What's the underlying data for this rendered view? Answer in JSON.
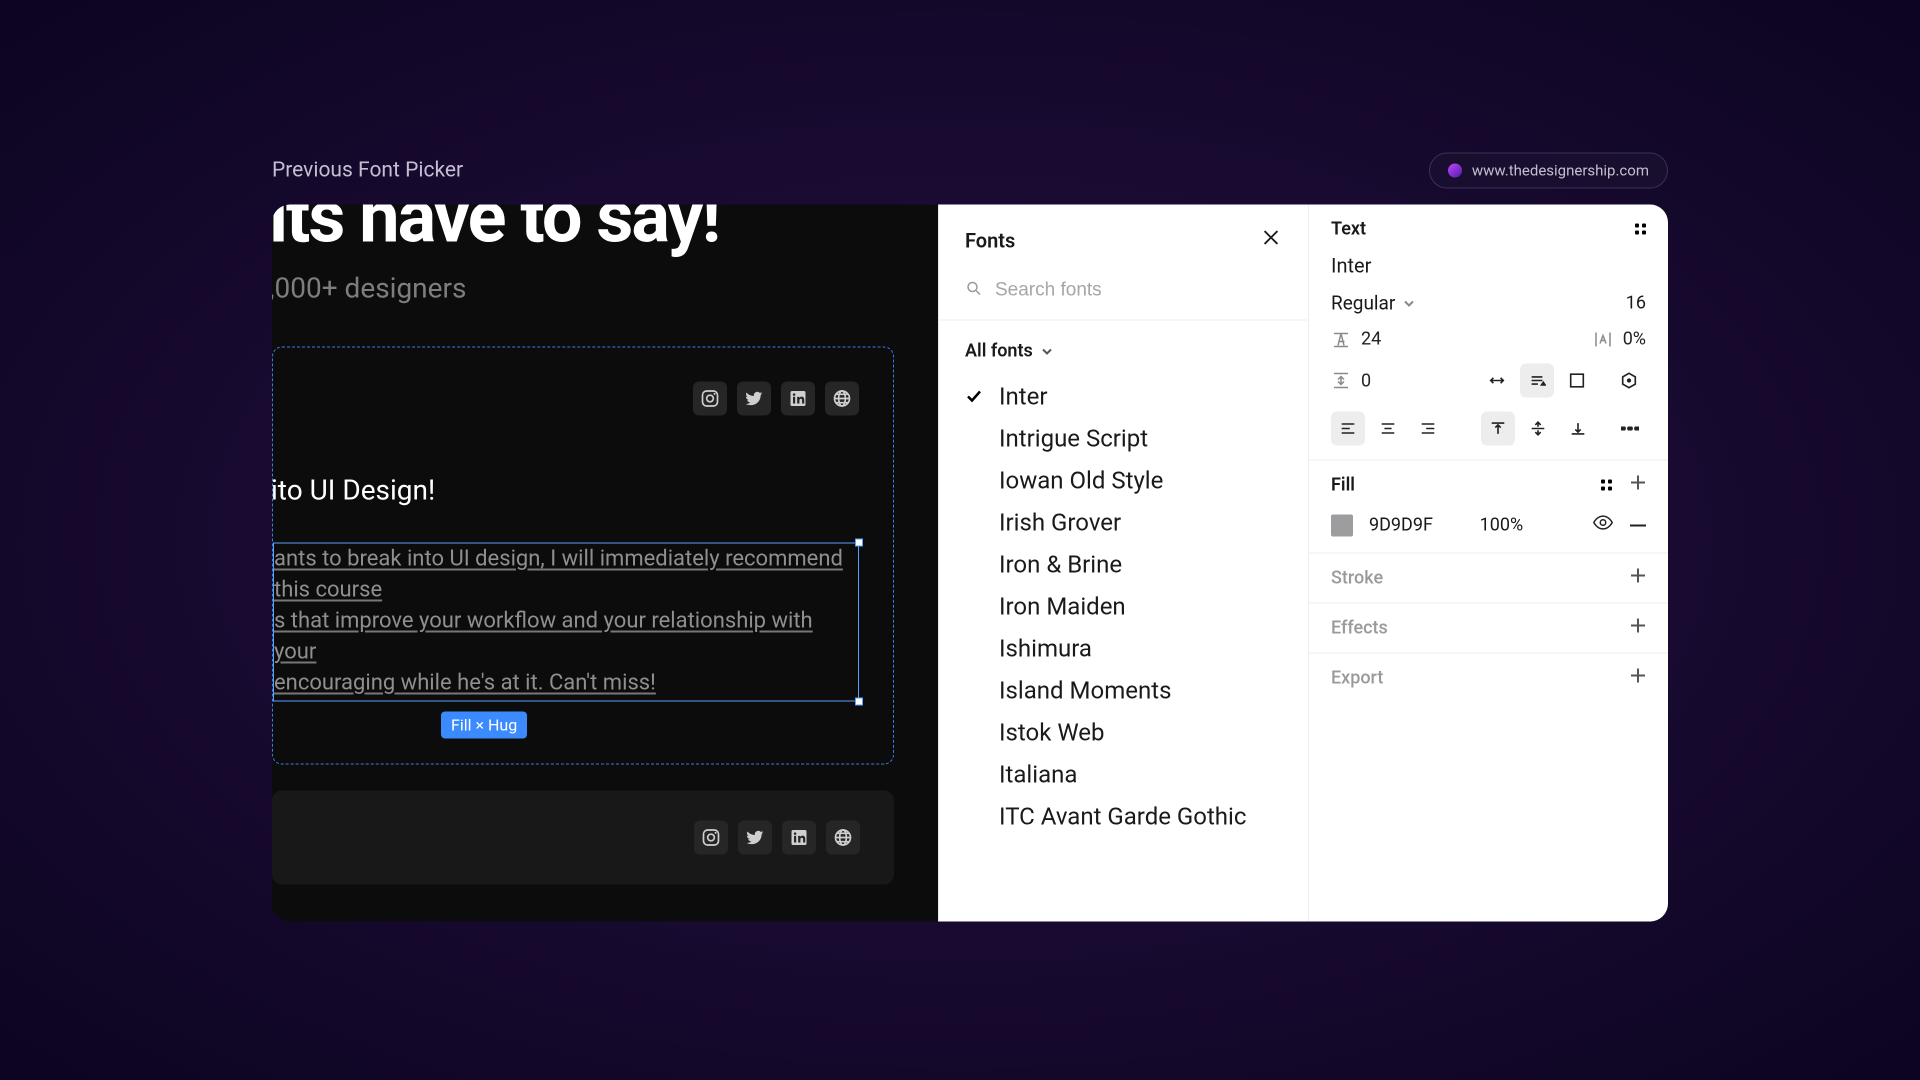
{
  "header": {
    "title": "Previous Font Picker",
    "site_label": "www.thedesignership.com"
  },
  "canvas": {
    "heading": "its have to say!",
    "subheading": ",000+ designers",
    "card_heading": "ito UI Design!",
    "selected_text_line1": "ants to break into UI design, I will immediately recommend this course ",
    "selected_text_line2": "s that improve your workflow and your relationship with your ",
    "selected_text_line3": "encouraging while he's at it. Can't miss!",
    "badge": "Fill × Hug"
  },
  "fonts": {
    "title": "Fonts",
    "search_placeholder": "Search fonts",
    "filter_label": "All fonts",
    "items": [
      {
        "name": "Inter",
        "selected": true
      },
      {
        "name": "Intrigue Script",
        "selected": false
      },
      {
        "name": "Iowan Old Style",
        "selected": false
      },
      {
        "name": "Irish Grover",
        "selected": false
      },
      {
        "name": "Iron & Brine",
        "selected": false
      },
      {
        "name": "Iron Maiden",
        "selected": false
      },
      {
        "name": "Ishimura",
        "selected": false
      },
      {
        "name": "Island Moments",
        "selected": false
      },
      {
        "name": "Istok Web",
        "selected": false
      },
      {
        "name": "Italiana",
        "selected": false
      },
      {
        "name": "ITC Avant Garde Gothic",
        "selected": false
      }
    ]
  },
  "inspector": {
    "text": {
      "label": "Text",
      "font_family": "Inter",
      "weight": "Regular",
      "size": "16",
      "line_height": "24",
      "letter_spacing": "0%",
      "paragraph_spacing": "0"
    },
    "fill": {
      "label": "Fill",
      "hex": "9D9D9F",
      "opacity": "100%"
    },
    "stroke": {
      "label": "Stroke"
    },
    "effects": {
      "label": "Effects"
    },
    "export": {
      "label": "Export"
    }
  }
}
